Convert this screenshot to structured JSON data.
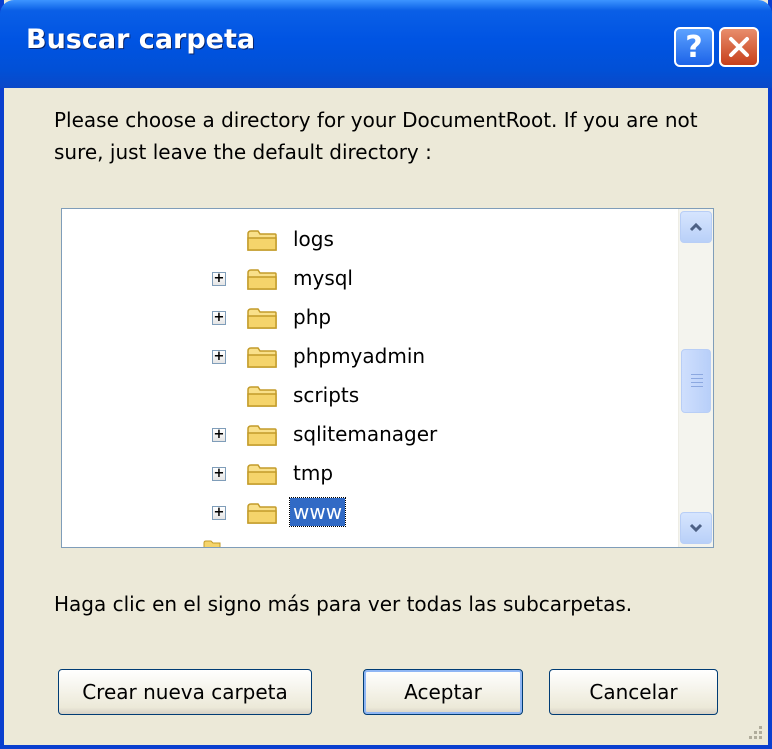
{
  "window": {
    "title": "Buscar carpeta",
    "help_label": "?"
  },
  "description": "Please choose a directory for your DocumentRoot. If you are not sure, just leave the default directory :",
  "tree": {
    "items": [
      {
        "label": "logs",
        "expandable": false,
        "selected": false
      },
      {
        "label": "mysql",
        "expandable": true,
        "selected": false
      },
      {
        "label": "php",
        "expandable": true,
        "selected": false
      },
      {
        "label": "phpmyadmin",
        "expandable": true,
        "selected": false
      },
      {
        "label": "scripts",
        "expandable": false,
        "selected": false
      },
      {
        "label": "sqlitemanager",
        "expandable": true,
        "selected": false
      },
      {
        "label": "tmp",
        "expandable": true,
        "selected": false
      },
      {
        "label": "www",
        "expandable": true,
        "selected": true
      }
    ],
    "expander_glyph": "+"
  },
  "hint": "Haga clic en el signo más para ver todas las subcarpetas.",
  "buttons": {
    "new_folder": "Crear nueva carpeta",
    "ok": "Aceptar",
    "cancel": "Cancelar"
  },
  "colors": {
    "titlebar": "#0054e3",
    "selection": "#316ac5",
    "dialog_bg": "#ece9d8",
    "folder": "#f5d46b"
  },
  "icons": [
    "help-icon",
    "close-icon",
    "folder-icon",
    "expand-icon",
    "scroll-up-icon",
    "scroll-down-icon",
    "resize-grip-icon"
  ]
}
